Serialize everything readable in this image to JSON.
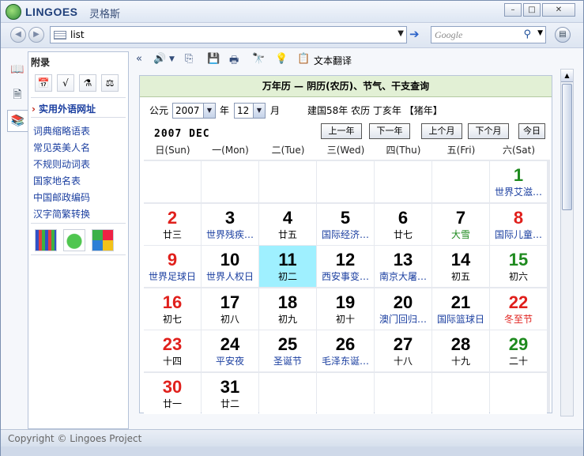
{
  "app": {
    "brand": "LINGOES",
    "brand_cn": "灵格斯"
  },
  "window_buttons": [
    "–",
    "□",
    "✕"
  ],
  "address": {
    "value": "list",
    "search_placeholder": "Google"
  },
  "sidebar": {
    "title": "附录",
    "heading": "实用外语网址",
    "links": [
      "词典缩略语表",
      "常见英美人名",
      "不规则动词表",
      "国家地名表",
      "中国邮政编码",
      "汉字简繁转换"
    ]
  },
  "toolbar": {
    "translate_label": "文本翻译"
  },
  "calendar": {
    "header": "万年历 — 阴历(农历)、节气、干支查询",
    "gongyuan_label": "公元",
    "year_value": "2007",
    "year_label": "年",
    "month_value": "12",
    "month_label": "月",
    "info": "建国58年 农历 丁亥年 【猪年】",
    "year_month_display": "2007 DEC",
    "buttons": {
      "prev_year": "上一年",
      "next_year": "下一年",
      "prev_month": "上个月",
      "next_month": "下个月",
      "today": "今日"
    },
    "weekdays": [
      "日(Sun)",
      "一(Mon)",
      "二(Tue)",
      "三(Wed)",
      "四(Thu)",
      "五(Fri)",
      "六(Sat)"
    ],
    "weeks": [
      [
        null,
        null,
        null,
        null,
        null,
        null,
        {
          "day": "1",
          "lunar": "世界艾滋…",
          "dcolor": "#1e8a1e",
          "lcolor": "#1b3fa0"
        }
      ],
      [
        {
          "day": "2",
          "lunar": "廿三",
          "dcolor": "#e0201c",
          "lcolor": "#000"
        },
        {
          "day": "3",
          "lunar": "世界残疾…",
          "dcolor": "#000",
          "lcolor": "#1b3fa0"
        },
        {
          "day": "4",
          "lunar": "廿五",
          "dcolor": "#000",
          "lcolor": "#000"
        },
        {
          "day": "5",
          "lunar": "国际经济…",
          "dcolor": "#000",
          "lcolor": "#1b3fa0"
        },
        {
          "day": "6",
          "lunar": "廿七",
          "dcolor": "#000",
          "lcolor": "#000"
        },
        {
          "day": "7",
          "lunar": "大雪",
          "dcolor": "#000",
          "lcolor": "#1e8a1e"
        },
        {
          "day": "8",
          "lunar": "国际儿童…",
          "dcolor": "#e0201c",
          "lcolor": "#1b3fa0"
        }
      ],
      [
        {
          "day": "9",
          "lunar": "世界足球日",
          "dcolor": "#e0201c",
          "lcolor": "#1b3fa0"
        },
        {
          "day": "10",
          "lunar": "世界人权日",
          "dcolor": "#000",
          "lcolor": "#1b3fa0"
        },
        {
          "day": "11",
          "lunar": "初二",
          "dcolor": "#000",
          "lcolor": "#000",
          "today": true
        },
        {
          "day": "12",
          "lunar": "西安事变…",
          "dcolor": "#000",
          "lcolor": "#1b3fa0"
        },
        {
          "day": "13",
          "lunar": "南京大屠…",
          "dcolor": "#000",
          "lcolor": "#1b3fa0"
        },
        {
          "day": "14",
          "lunar": "初五",
          "dcolor": "#000",
          "lcolor": "#000"
        },
        {
          "day": "15",
          "lunar": "初六",
          "dcolor": "#1e8a1e",
          "lcolor": "#000"
        }
      ],
      [
        {
          "day": "16",
          "lunar": "初七",
          "dcolor": "#e0201c",
          "lcolor": "#000"
        },
        {
          "day": "17",
          "lunar": "初八",
          "dcolor": "#000",
          "lcolor": "#000"
        },
        {
          "day": "18",
          "lunar": "初九",
          "dcolor": "#000",
          "lcolor": "#000"
        },
        {
          "day": "19",
          "lunar": "初十",
          "dcolor": "#000",
          "lcolor": "#000"
        },
        {
          "day": "20",
          "lunar": "澳门回归…",
          "dcolor": "#000",
          "lcolor": "#1b3fa0"
        },
        {
          "day": "21",
          "lunar": "国际篮球日",
          "dcolor": "#000",
          "lcolor": "#1b3fa0"
        },
        {
          "day": "22",
          "lunar": "冬至节",
          "dcolor": "#e0201c",
          "lcolor": "#e0201c"
        }
      ],
      [
        {
          "day": "23",
          "lunar": "十四",
          "dcolor": "#e0201c",
          "lcolor": "#000"
        },
        {
          "day": "24",
          "lunar": "平安夜",
          "dcolor": "#000",
          "lcolor": "#1b3fa0"
        },
        {
          "day": "25",
          "lunar": "圣诞节",
          "dcolor": "#000",
          "lcolor": "#1b3fa0"
        },
        {
          "day": "26",
          "lunar": "毛泽东诞…",
          "dcolor": "#000",
          "lcolor": "#1b3fa0"
        },
        {
          "day": "27",
          "lunar": "十八",
          "dcolor": "#000",
          "lcolor": "#000"
        },
        {
          "day": "28",
          "lunar": "十九",
          "dcolor": "#000",
          "lcolor": "#000"
        },
        {
          "day": "29",
          "lunar": "二十",
          "dcolor": "#1e8a1e",
          "lcolor": "#000"
        }
      ],
      [
        {
          "day": "30",
          "lunar": "廿一",
          "dcolor": "#e0201c",
          "lcolor": "#000"
        },
        {
          "day": "31",
          "lunar": "廿二",
          "dcolor": "#000",
          "lcolor": "#000"
        },
        null,
        null,
        null,
        null,
        null
      ]
    ]
  },
  "status": {
    "text": "Copyright © Lingoes Project"
  }
}
